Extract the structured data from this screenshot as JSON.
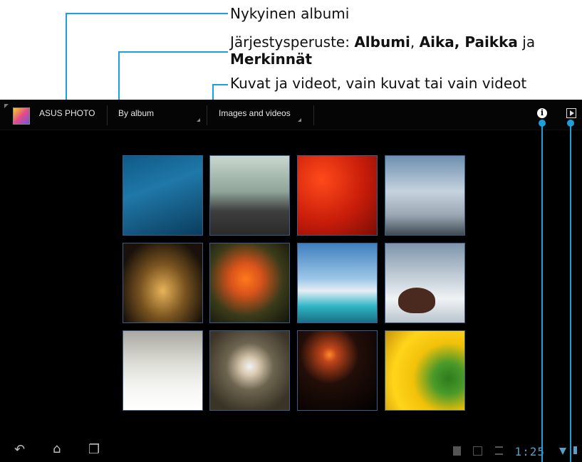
{
  "annotations": {
    "current_album": "Nykyinen albumi",
    "sort_prefix": "Järjestysperuste: ",
    "sort_album": "Albumi",
    "sort_sep1": ", ",
    "sort_time_place": "Aika, Paikka",
    "sort_and": " ja",
    "sort_tags": "Merkinnät",
    "media_filter": "Kuvat ja videot, vain kuvat tai vain videot"
  },
  "actionbar": {
    "app_title": "ASUS PHOTO",
    "sort_value": "By album",
    "filter_value": "Images and videos",
    "info_icon": "info-icon",
    "slideshow_icon": "play-icon"
  },
  "gallery": {
    "thumbnails": [
      "lake-shore",
      "couple-walking",
      "red-lanterns",
      "cloudy-sky",
      "night-building",
      "clownfish",
      "harbor-boats",
      "rock-in-sea",
      "sleeping-kitten",
      "white-flower",
      "sky-lanterns",
      "sunflower"
    ]
  },
  "statusbar": {
    "time": "1:25"
  },
  "colors": {
    "accent": "#1ba0dc",
    "background": "#000000"
  }
}
